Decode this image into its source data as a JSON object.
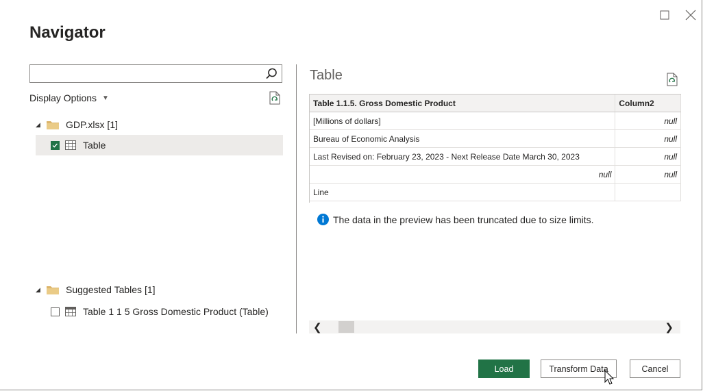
{
  "window": {
    "title": "Navigator"
  },
  "search": {
    "value": "",
    "placeholder": ""
  },
  "left": {
    "display_options": "Display Options",
    "tree": [
      {
        "label": "GDP.xlsx [1]",
        "icon": "folder-icon"
      },
      {
        "label": "Table",
        "icon": "table-icon",
        "checked": true,
        "selected": true
      }
    ],
    "suggested": [
      {
        "label": "Suggested Tables [1]",
        "icon": "folder-icon"
      },
      {
        "label": "Table 1 1 5 Gross Domestic Product (Table)",
        "icon": "table-icon",
        "checked": false
      }
    ]
  },
  "preview": {
    "title": "Table",
    "columns": [
      "Table 1.1.5. Gross Domestic Product",
      "Column2"
    ],
    "rows": [
      [
        "[Millions of dollars]",
        "null"
      ],
      [
        "Bureau of Economic Analysis",
        "null"
      ],
      [
        "Last Revised on: February 23, 2023 - Next Release Date March 30, 2023",
        "null"
      ],
      [
        "null",
        "null"
      ],
      [
        "Line",
        ""
      ]
    ],
    "truncated_message": "The data in the preview has been truncated due to size limits."
  },
  "buttons": {
    "load": "Load",
    "transform": "Transform Data",
    "cancel": "Cancel"
  },
  "colors": {
    "accent": "#217346",
    "info": "#0078d4",
    "folder": "#dcb46a"
  }
}
